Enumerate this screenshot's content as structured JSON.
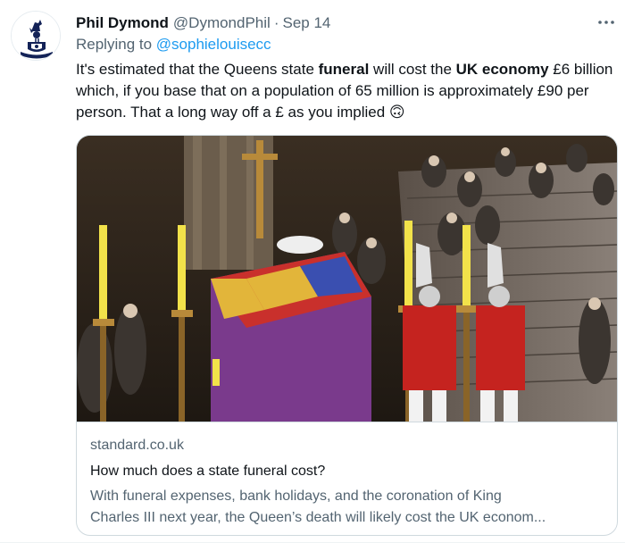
{
  "author": {
    "name": "Phil Dymond",
    "handle": "@DymondPhil",
    "separator": "·",
    "date": "Sep 14",
    "avatar_icon": "cockerel-crest-icon"
  },
  "reply": {
    "prefix": "Replying to ",
    "mention": "@sophielouisecc"
  },
  "tweet": {
    "parts": [
      {
        "text": "It's estimated that the Queens state ",
        "bold": false
      },
      {
        "text": "funeral",
        "bold": true
      },
      {
        "text": " will cost the ",
        "bold": false
      },
      {
        "text": "UK economy",
        "bold": true
      },
      {
        "text": " £6 billion which, if you base that on a population of 65 million is approximately £90 per person. That a long way off a £ as you implied ",
        "bold": false
      }
    ],
    "emoji": "🙃"
  },
  "card": {
    "domain": "standard.co.uk",
    "title": "How much does a state funeral cost?",
    "description_line1": "With funeral expenses, bank holidays, and the coronation of King",
    "description_line2": "Charles III next year, the Queen’s death will likely cost the UK econom...",
    "image_icon": "state-funeral-photo"
  },
  "colors": {
    "text": "#0f1419",
    "secondary": "#536471",
    "link": "#1d9bf0",
    "border": "#cfd9de"
  },
  "menu_icon": "more-dots-icon"
}
